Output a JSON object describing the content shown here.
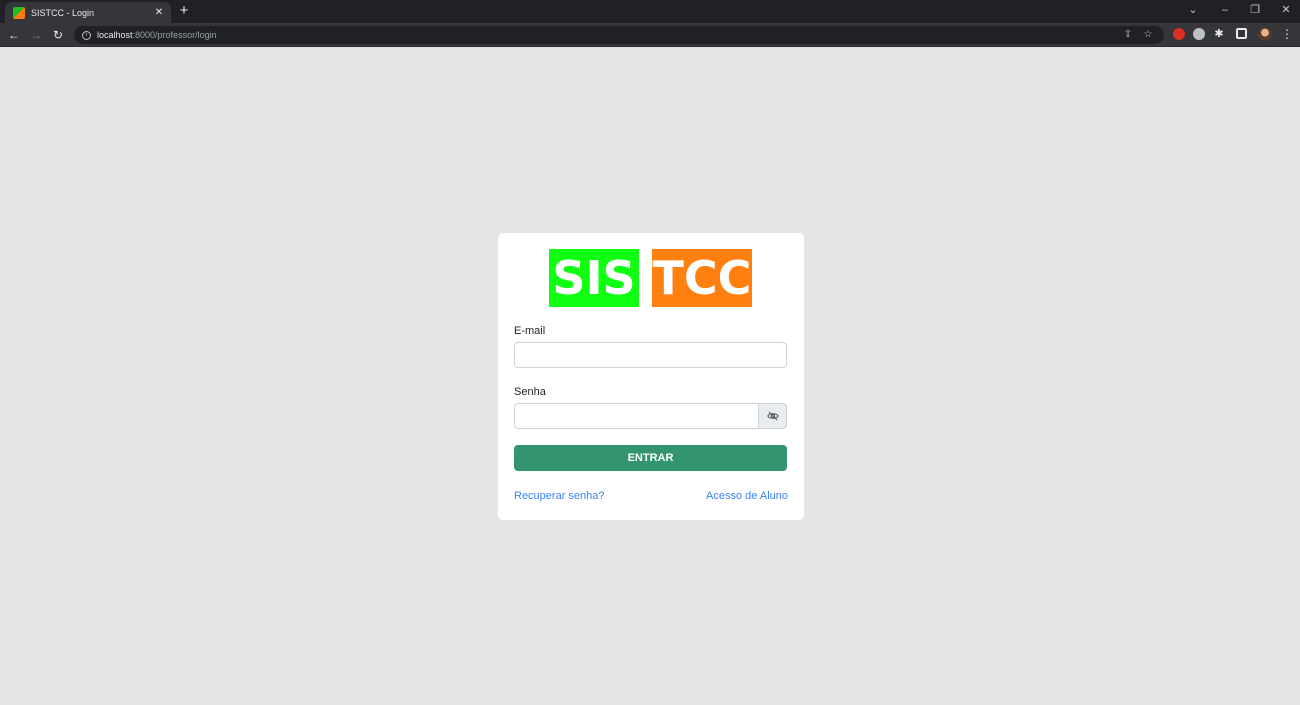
{
  "browser": {
    "tab_title": "SISTCC - Login",
    "tab_close": "✕",
    "new_tab": "+",
    "url_host": "localhost",
    "url_path": ":8000/professor/login"
  },
  "logo": {
    "part1": "SIS",
    "part2": "TCC",
    "part1_color": "#11ff11",
    "part2_color": "#ff7f0f"
  },
  "form": {
    "email_label": "E-mail",
    "email_value": "",
    "password_label": "Senha",
    "password_value": "",
    "submit_label": "ENTRAR",
    "submit_color": "#339470"
  },
  "links": {
    "recover": "Recuperar senha?",
    "student_access": "Acesso de Aluno",
    "color": "#3b82f6"
  }
}
